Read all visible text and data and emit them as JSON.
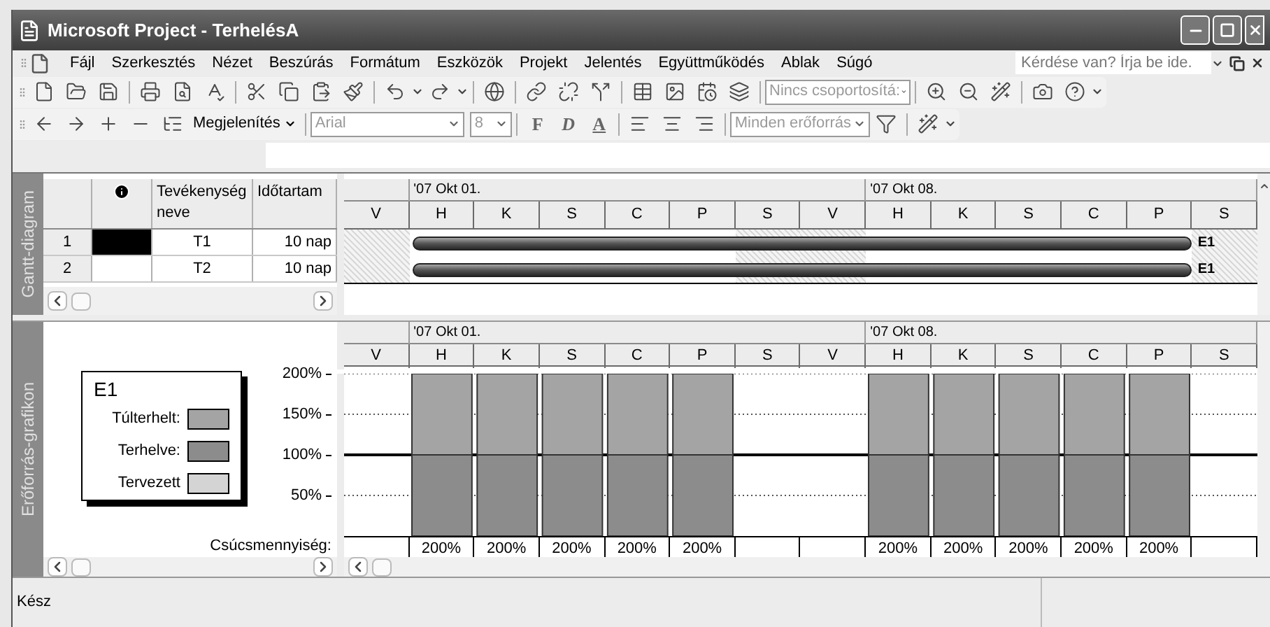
{
  "window": {
    "title": "Microsoft Project - TerhelésA"
  },
  "menu": {
    "items": [
      "Fájl",
      "Szerkesztés",
      "Nézet",
      "Beszúrás",
      "Formátum",
      "Eszközök",
      "Projekt",
      "Jelentés",
      "Együttműködés",
      "Ablak",
      "Súgó"
    ],
    "help_box": {
      "placeholder": "Kérdése van? Írja be ide."
    }
  },
  "standard_toolbar": {
    "group_dropdown": "Nincs csoportosítá:"
  },
  "formatting_toolbar": {
    "show_menu": "Megjelenítés",
    "font": "Arial",
    "font_size": "8",
    "style_buttons": [
      "F",
      "D",
      "A"
    ],
    "resource_filter": "Minden erőforrás"
  },
  "gantt": {
    "side_label": "Gantt-diagram",
    "columns": [
      "Tevékenység neve",
      "Időtartam"
    ],
    "rows": [
      {
        "id": "1",
        "indicator_selected": true,
        "name": "T1",
        "duration": "10 nap",
        "resource": "E1"
      },
      {
        "id": "2",
        "indicator_selected": false,
        "name": "T2",
        "duration": "10 nap",
        "resource": "E1"
      }
    ],
    "weeks": [
      "'07 Okt 01.",
      "'07 Okt 08."
    ],
    "days": [
      {
        "label": "V",
        "nonworking": true
      },
      {
        "label": "H",
        "nonworking": false
      },
      {
        "label": "K",
        "nonworking": false
      },
      {
        "label": "S",
        "nonworking": false
      },
      {
        "label": "C",
        "nonworking": false
      },
      {
        "label": "P",
        "nonworking": false
      },
      {
        "label": "S",
        "nonworking": true
      },
      {
        "label": "V",
        "nonworking": true
      },
      {
        "label": "H",
        "nonworking": false
      },
      {
        "label": "K",
        "nonworking": false
      },
      {
        "label": "S",
        "nonworking": false
      },
      {
        "label": "C",
        "nonworking": false
      },
      {
        "label": "P",
        "nonworking": false
      },
      {
        "label": "S",
        "nonworking": true
      }
    ]
  },
  "graph": {
    "side_label": "Erőforrás-grafikon",
    "weeks": [
      "'07 Okt 01.",
      "'07 Okt 08."
    ],
    "legend": {
      "title": "E1",
      "extra_items": [
        {
          "label": "Tervezett",
          "color": "#d4d4d4"
        }
      ]
    },
    "peak_label": "Csúcsmennyiség:",
    "peak_values": [
      "200%",
      "200%",
      "200%",
      "200%",
      "200%",
      "200%",
      "200%",
      "200%",
      "200%",
      "200%"
    ],
    "chart_data": {
      "type": "bar",
      "stacked": true,
      "categories": [
        "V",
        "H",
        "K",
        "S",
        "C",
        "P",
        "S",
        "V",
        "H",
        "K",
        "S",
        "C",
        "P",
        "S"
      ],
      "ylim": [
        0,
        200
      ],
      "yticks": [
        {
          "value": 50,
          "label": "50%"
        },
        {
          "value": 100,
          "label": "100%"
        },
        {
          "value": 150,
          "label": "150%"
        },
        {
          "value": 200,
          "label": "200%"
        }
      ],
      "ref_lines": [
        {
          "axis": "y",
          "value": 100
        }
      ],
      "legend": "left",
      "series": [
        {
          "name": "Terhelve:",
          "color": "#8c8c8c",
          "values": [
            0,
            100,
            100,
            100,
            100,
            100,
            0,
            0,
            100,
            100,
            100,
            100,
            100,
            0
          ]
        },
        {
          "name": "Túlterhelt:",
          "color": "#a4a4a4",
          "values": [
            0,
            100,
            100,
            100,
            100,
            100,
            0,
            0,
            100,
            100,
            100,
            100,
            100,
            0
          ]
        }
      ]
    }
  },
  "status_bar": {
    "text": "Kész"
  }
}
